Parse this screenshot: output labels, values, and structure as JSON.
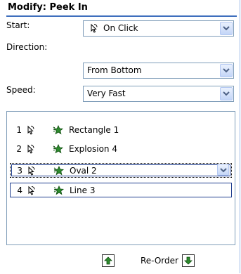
{
  "panel": {
    "title": "Modify: Peek In"
  },
  "fields": {
    "start": {
      "label": "Start:",
      "value": "On Click",
      "icon": "mouse-click-icon"
    },
    "direction": {
      "label": "Direction:",
      "value": "From Bottom"
    },
    "speed": {
      "label": "Speed:",
      "value": "Very Fast"
    }
  },
  "animation_list": {
    "items": [
      {
        "index": "1",
        "name": "Rectangle 1",
        "trigger_icon": "mouse-click-icon",
        "effect_icon": "entrance-star-icon"
      },
      {
        "index": "2",
        "name": "Explosion 4",
        "trigger_icon": "mouse-click-icon",
        "effect_icon": "entrance-star-icon"
      },
      {
        "index": "3",
        "name": "Oval 2",
        "trigger_icon": "mouse-click-icon",
        "effect_icon": "entrance-star-icon",
        "state": "selected"
      },
      {
        "index": "4",
        "name": "Line 3",
        "trigger_icon": "mouse-click-icon",
        "effect_icon": "entrance-star-icon",
        "state": "focused"
      }
    ]
  },
  "reorder": {
    "label": "Re-Order",
    "up_icon": "arrow-up-icon",
    "down_icon": "arrow-down-icon"
  },
  "colors": {
    "header_rule": "#3f6fbd",
    "field_border": "#7f9db9",
    "selection_border": "#1e3d8e",
    "star_green": "#2e8b2e"
  }
}
